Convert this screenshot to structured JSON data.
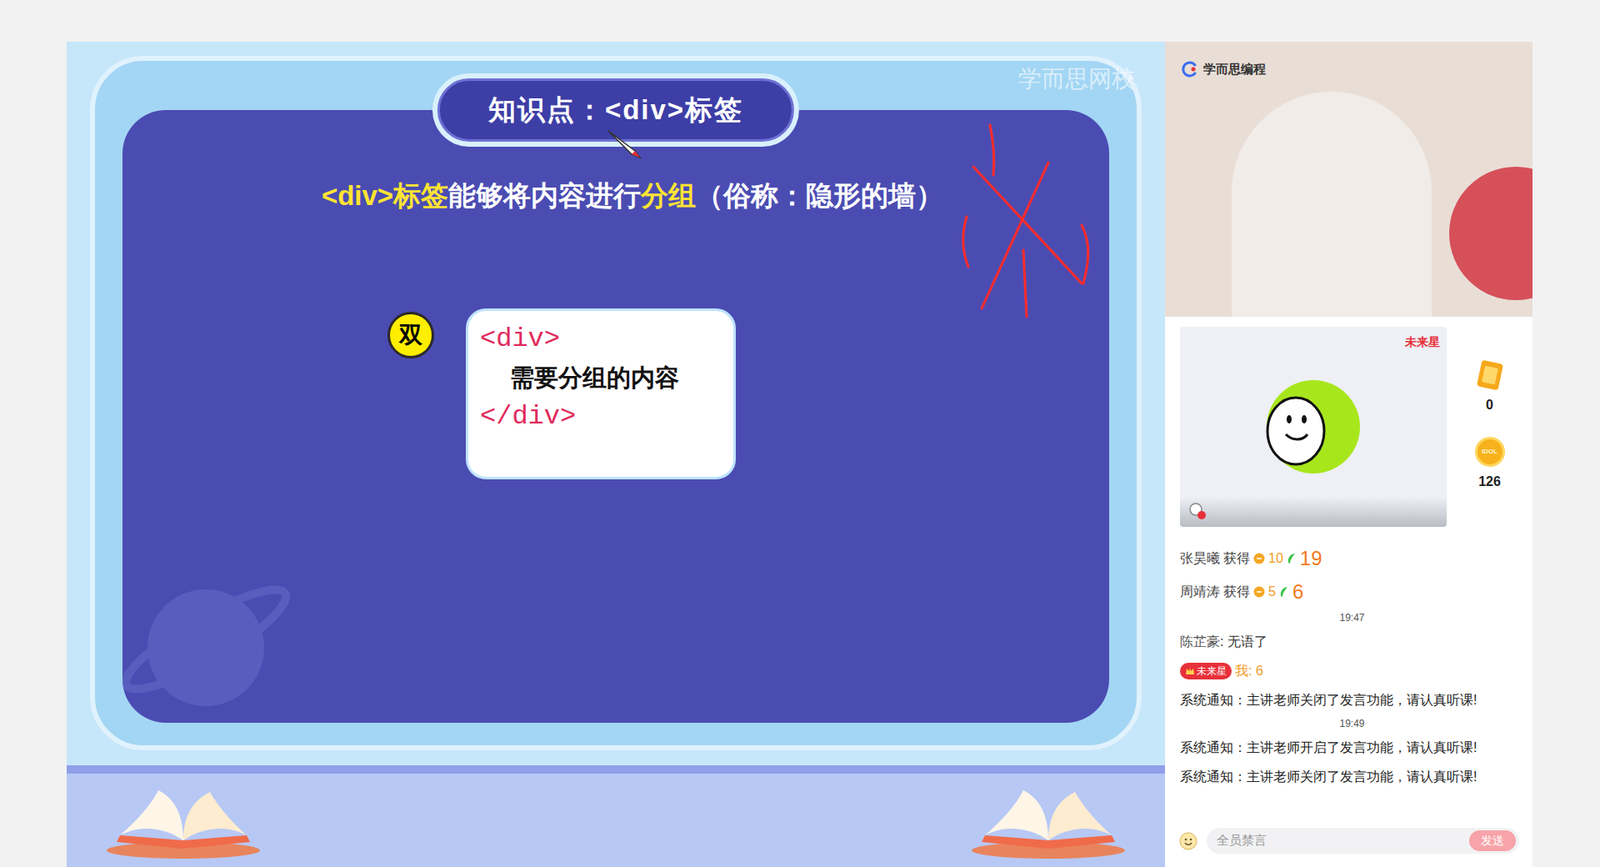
{
  "slide": {
    "watermark": "学而思网校",
    "title": "知识点：<div>标签",
    "statement": [
      {
        "text": "<div>标签",
        "highlight": true
      },
      {
        "text": "能够将内容进行",
        "highlight": false
      },
      {
        "text": "分组",
        "highlight": true
      },
      {
        "text": "（俗称：隐形的墙）",
        "highlight": false
      }
    ],
    "badge": "双",
    "code": {
      "open": "<div>",
      "content": "需要分组的内容",
      "close": "</div>"
    }
  },
  "teacher_video": {
    "logo": "学而思编程"
  },
  "student_card": {
    "badge": "未来星"
  },
  "stats": [
    {
      "kind": "card",
      "value": "0",
      "label": ""
    },
    {
      "kind": "coin",
      "value": "126",
      "label": "IDOL"
    }
  ],
  "chat": [
    {
      "kind": "reward",
      "name": "张昊曦",
      "verb": "获得",
      "coins": "10",
      "points": "19"
    },
    {
      "kind": "reward",
      "name": "周靖涛",
      "verb": "获得",
      "coins": "5",
      "points": "6"
    },
    {
      "kind": "time",
      "text": "19:47"
    },
    {
      "kind": "message",
      "name": "陈芷豪",
      "text": "无语了"
    },
    {
      "kind": "self",
      "badge": "未来星",
      "text": "我: 6"
    },
    {
      "kind": "system",
      "text": "系统通知：主讲老师关闭了发言功能，请认真听课!"
    },
    {
      "kind": "time",
      "text": "19:49"
    },
    {
      "kind": "system",
      "text": "系统通知：主讲老师开启了发言功能，请认真听课!"
    },
    {
      "kind": "system",
      "text": "系统通知：主讲老师关闭了发言功能，请认真听课!"
    }
  ],
  "input": {
    "placeholder": "全员禁言",
    "send": "发送"
  }
}
